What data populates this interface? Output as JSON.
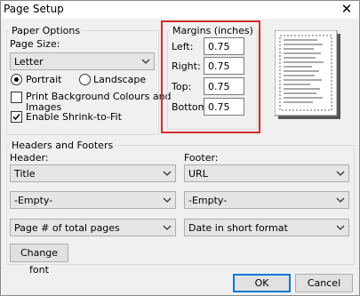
{
  "window": {
    "title": "Page Setup",
    "close_glyph": "✕"
  },
  "paper_options": {
    "legend": "Paper Options",
    "page_size_label": "Page Size:",
    "page_size_value": "Letter",
    "portrait_label": "Portrait",
    "landscape_label": "Landscape",
    "orientation_selected": "Portrait",
    "print_bg_label_line1": "Print Background Colours and",
    "print_bg_label_line2": "Images",
    "print_bg_checked": false,
    "shrink_label": "Enable Shrink-to-Fit",
    "shrink_checked": true
  },
  "margins": {
    "legend": "Margins (inches)",
    "left_label": "Left:",
    "left_value": "0.75",
    "right_label": "Right:",
    "right_value": "0.75",
    "top_label": "Top:",
    "top_value": "0.75",
    "bottom_label": "Bottom:",
    "bottom_value": "0.75"
  },
  "headers_footers": {
    "legend": "Headers and Footers",
    "header_label": "Header:",
    "footer_label": "Footer:",
    "header_values": [
      "Title",
      "-Empty-",
      "Page # of total pages"
    ],
    "footer_values": [
      "URL",
      "-Empty-",
      "Date in short format"
    ],
    "change_font_label": "Change font"
  },
  "buttons": {
    "ok_label": "OK",
    "cancel_label": "Cancel"
  },
  "colors": {
    "highlight": "#d22c2c",
    "dialog_bg": "#f0f0f0",
    "default_button_border": "#0078d7"
  }
}
